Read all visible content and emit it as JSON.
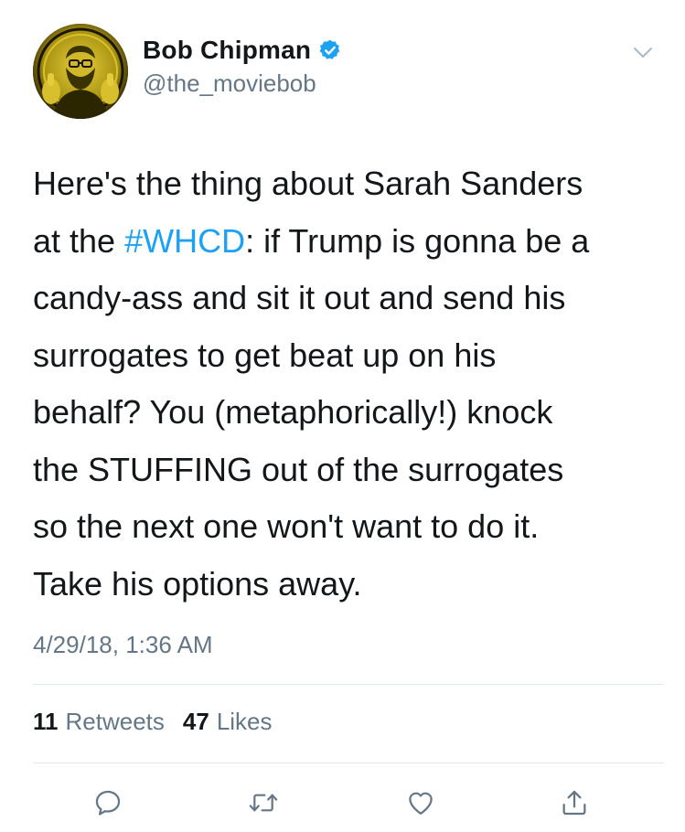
{
  "author": {
    "display_name": "Bob Chipman",
    "handle": "@the_moviebob",
    "verified": true,
    "avatar_icon": "avatar-photo"
  },
  "tweet": {
    "lines": [
      {
        "segments": [
          {
            "text": "Here's the thing about Sarah Sanders",
            "type": "text"
          }
        ]
      },
      {
        "segments": [
          {
            "text": "at the ",
            "type": "text"
          },
          {
            "text": "#WHCD",
            "type": "hashtag"
          },
          {
            "text": ": if Trump is gonna be a",
            "type": "text"
          }
        ]
      },
      {
        "segments": [
          {
            "text": "candy-ass and sit it out and send his",
            "type": "text"
          }
        ]
      },
      {
        "segments": [
          {
            "text": "surrogates to get beat up on his",
            "type": "text"
          }
        ]
      },
      {
        "segments": [
          {
            "text": "behalf? You (metaphorically!) knock",
            "type": "text"
          }
        ]
      },
      {
        "segments": [
          {
            "text": "the STUFFING out of the surrogates",
            "type": "text"
          }
        ]
      },
      {
        "segments": [
          {
            "text": "so the next one won't want to do it.",
            "type": "text"
          }
        ]
      },
      {
        "segments": [
          {
            "text": "Take his options away.",
            "type": "text"
          }
        ]
      }
    ],
    "timestamp": "4/29/18, 1:36 AM"
  },
  "stats": {
    "retweets_count": "11",
    "retweets_label": "Retweets",
    "likes_count": "47",
    "likes_label": "Likes"
  },
  "actions": [
    {
      "name": "reply-icon"
    },
    {
      "name": "retweet-icon"
    },
    {
      "name": "like-icon"
    },
    {
      "name": "share-icon"
    }
  ],
  "colors": {
    "text": "#14171a",
    "secondary": "#657786",
    "link": "#1da1f2",
    "divider": "#e1e8ed",
    "verified_badge": "#1da1f2"
  }
}
